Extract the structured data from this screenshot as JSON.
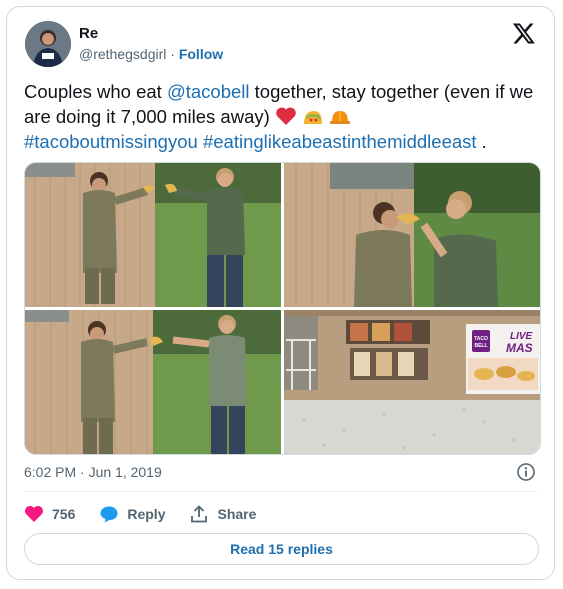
{
  "author": {
    "display_name": "Re",
    "handle": "@rethegsdgirl",
    "separator": " · ",
    "follow_label": "Follow"
  },
  "tweet": {
    "text_part1": "Couples who eat ",
    "mention": "@tacobell",
    "text_part2": " together, stay together (even if we are doing it 7,000 miles away) ",
    "hashtag1": "#tacoboutmissingyou",
    "hashtag2": "#eatinglikeabeastinthemiddleeast",
    "text_end": " ."
  },
  "photos": {
    "sign_line1": "LIVE",
    "sign_line2": "MAS",
    "sign_brand_line1": "TACO",
    "sign_brand_line2": "BELL"
  },
  "meta": {
    "timestamp": "6:02 PM · Jun 1, 2019"
  },
  "actions": {
    "like_count": "756",
    "reply_label": "Reply",
    "share_label": "Share"
  },
  "read_replies_label": "Read 15 replies",
  "colors": {
    "link": "#1d6fb0",
    "heart": "#f91880",
    "border": "#cfd9de",
    "muted": "#536471"
  }
}
